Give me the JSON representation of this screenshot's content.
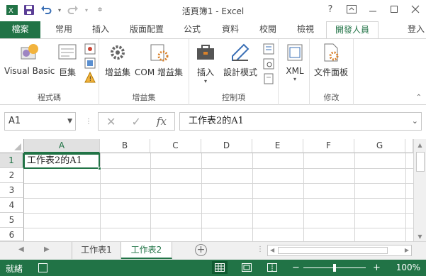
{
  "window": {
    "title": "活頁簿1 - Excel",
    "controls": [
      "help-icon",
      "ribbon-display-icon",
      "minimize-icon",
      "restore-icon",
      "close-icon"
    ]
  },
  "qat": {
    "icons": [
      "excel-logo-icon",
      "save-icon",
      "undo-icon",
      "redo-icon",
      "customize-qat-icon"
    ]
  },
  "tabs": {
    "file": "檔案",
    "items": [
      "常用",
      "插入",
      "版面配置",
      "公式",
      "資料",
      "校閱",
      "檢視",
      "開發人員"
    ],
    "active": "開發人員",
    "signin": "登入"
  },
  "ribbon": {
    "groups": [
      {
        "label": "程式碼",
        "buttons": [
          "Visual Basic",
          "巨集"
        ]
      },
      {
        "label": "增益集",
        "buttons": [
          "增益集",
          "COM 增益集"
        ]
      },
      {
        "label": "控制項",
        "buttons": [
          "插入",
          "設計模式"
        ]
      },
      {
        "label": "",
        "buttons": [
          "XML"
        ]
      },
      {
        "label": "修改",
        "buttons": [
          "文件面板"
        ]
      }
    ]
  },
  "formula_bar": {
    "name_box": "A1",
    "content": "工作表2的A1"
  },
  "grid": {
    "columns": [
      "A",
      "B",
      "C",
      "D",
      "E",
      "F",
      "G"
    ],
    "rows": [
      "1",
      "2",
      "3",
      "4",
      "5",
      "6"
    ],
    "selected_column": "A",
    "selected_row": "1",
    "active_cell_value": "工作表2的A1"
  },
  "sheets": {
    "tabs": [
      "工作表1",
      "工作表2"
    ],
    "active": "工作表2"
  },
  "status": {
    "ready": "就緒",
    "zoom": "100%",
    "zoom_out": "−",
    "zoom_in": "+",
    "colors": {
      "accent": "#217346",
      "status_bg": "#217346"
    }
  }
}
